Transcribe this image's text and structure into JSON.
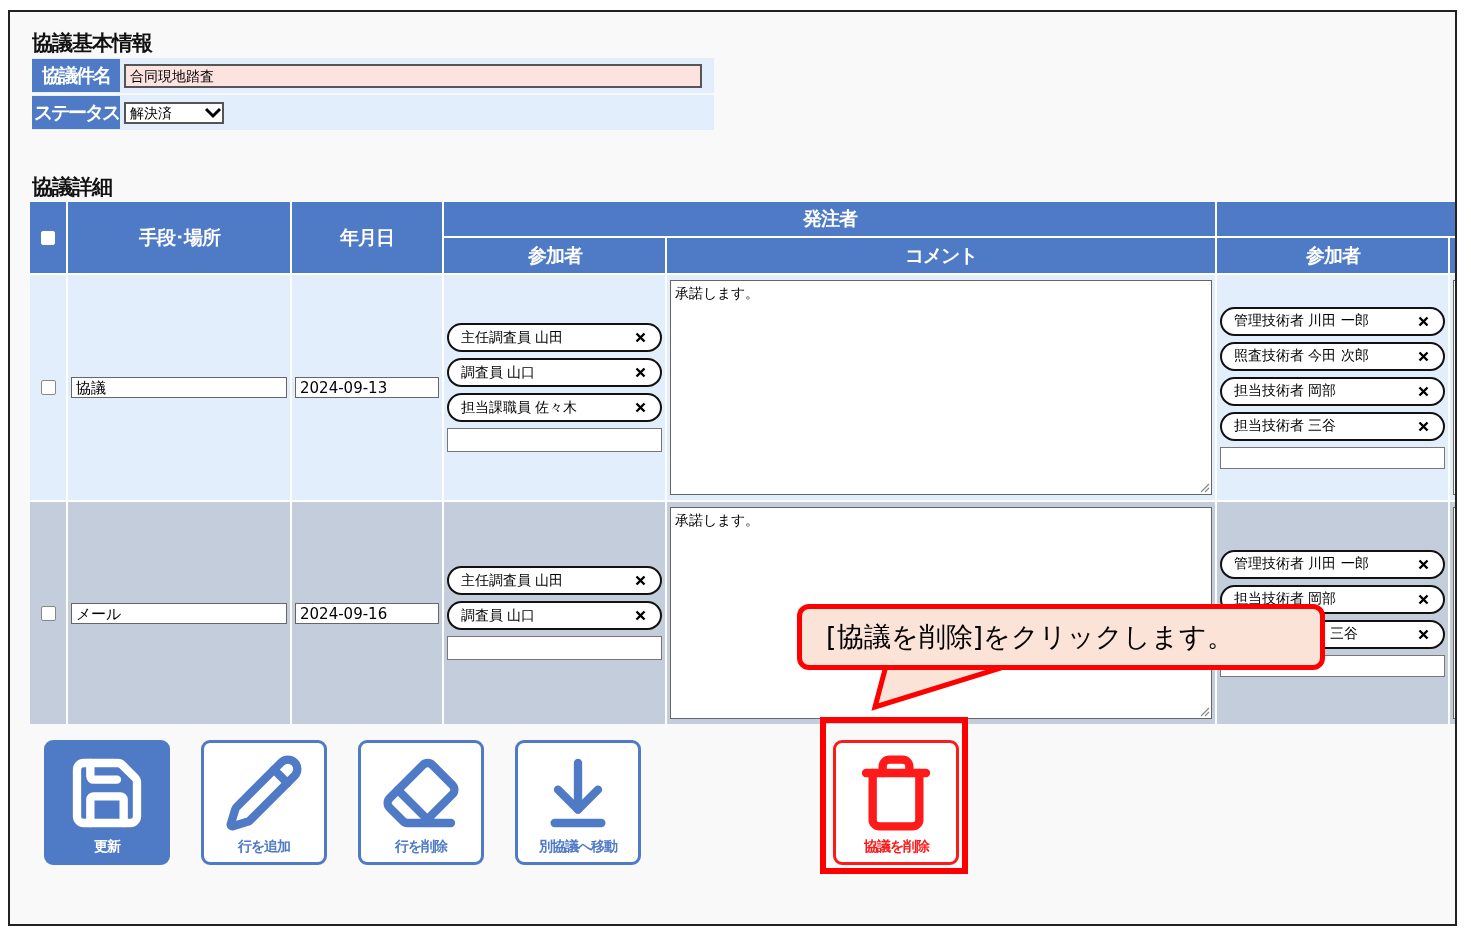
{
  "basic_info": {
    "title": "協議基本情報",
    "fields": [
      {
        "kind": "text",
        "label": "協議件名",
        "value": "合同現地踏査"
      },
      {
        "kind": "select",
        "label": "ステータス",
        "value": "解決済"
      }
    ]
  },
  "details": {
    "title": "協議詳細",
    "select_all_checked": false,
    "group": "発注者",
    "columns": [
      "手段･場所",
      "年月日",
      "参加者",
      "コメント",
      "参加者"
    ],
    "rows": [
      {
        "checked": false,
        "highlighted": false,
        "method": "協議",
        "date": "2024-09-13",
        "orderer_participants": [
          "主任調査員 山田",
          "調査員 山口",
          "担当課職員 佐々木"
        ],
        "comment": "承諾します。",
        "contractor_participants": [
          {
            "text": "管理技術者 川田 一郎",
            "partial": false
          },
          {
            "text": "照査技術者 今田 次郎",
            "partial": false
          },
          {
            "text": "担当技術者 岡部",
            "partial": false
          },
          {
            "text": "担当技術者 三谷",
            "partial": false
          }
        ]
      },
      {
        "checked": false,
        "highlighted": true,
        "method": "メール",
        "date": "2024-09-16",
        "orderer_participants": [
          "主任調査員 山田",
          "調査員 山口"
        ],
        "comment": "承諾します。",
        "contractor_participants": [
          {
            "text": "管理技術者 川田 一郎",
            "partial": false
          },
          {
            "text": "担当技術者 岡部",
            "partial": false
          },
          {
            "text": "三谷",
            "partial": true
          }
        ]
      }
    ]
  },
  "buttons": [
    {
      "kind": "save",
      "label": "更新",
      "primary": true,
      "highlighted": false
    },
    {
      "kind": "add_row",
      "label": "行を追加",
      "primary": false,
      "highlighted": false
    },
    {
      "kind": "delete_row",
      "label": "行を削除",
      "primary": false,
      "highlighted": false
    },
    {
      "kind": "move",
      "label": "別協議へ移動",
      "primary": false,
      "highlighted": false
    },
    {
      "kind": "delete",
      "label": "協議を削除",
      "primary": false,
      "highlighted": true
    }
  ],
  "callout": {
    "text": "[協議を削除]をクリックします。"
  }
}
